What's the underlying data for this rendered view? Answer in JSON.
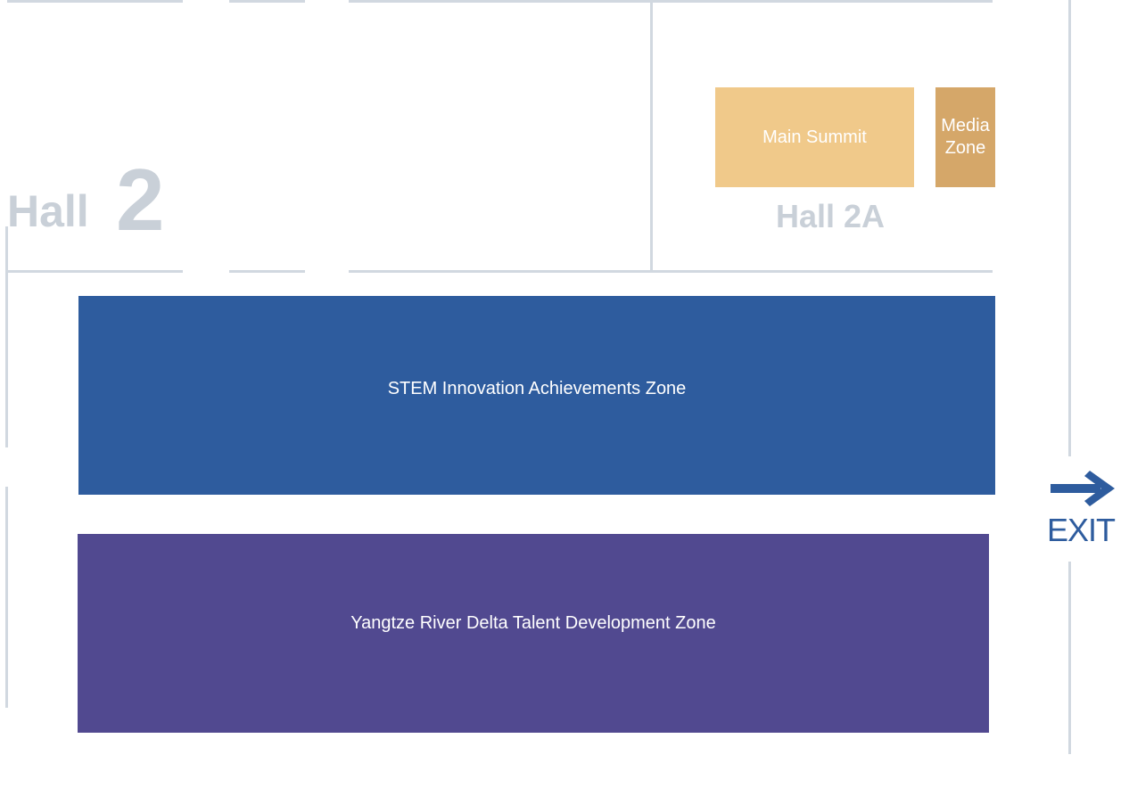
{
  "hall": {
    "prefix": "Hall",
    "number": "2"
  },
  "hall_2a": {
    "label": "Hall 2A"
  },
  "zones": {
    "main_summit": "Main Summit",
    "media_zone_line1": "Media",
    "media_zone_line2": "Zone",
    "stem": "STEM Innovation Achievements Zone",
    "yangtze": "Yangtze River Delta Talent Development Zone"
  },
  "exit": {
    "label": "EXIT",
    "icon": "arrow-right-icon"
  },
  "colors": {
    "wall": "#d1d8e0",
    "hall_label": "#c9d0d8",
    "main_summit": "#f0c98a",
    "media_zone": "#d5a769",
    "stem_zone": "#2e5c9e",
    "yangtze_zone": "#514990",
    "exit": "#2e5c9e"
  }
}
